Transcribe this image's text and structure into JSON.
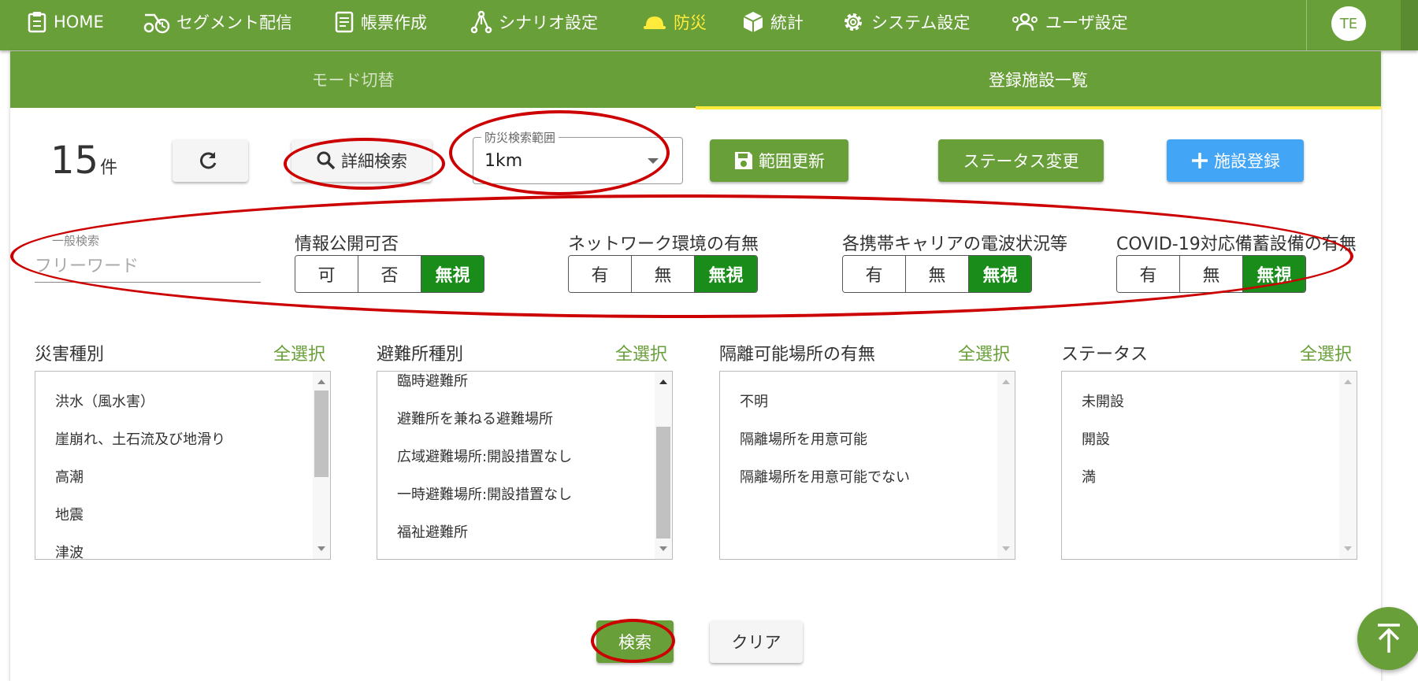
{
  "nav": {
    "items": [
      {
        "label": "HOME",
        "icon": "clipboard-icon"
      },
      {
        "label": "セグメント配信",
        "icon": "scooter-timer-icon"
      },
      {
        "label": "帳票作成",
        "icon": "document-icon"
      },
      {
        "label": "シナリオ設定",
        "icon": "graph-icon"
      },
      {
        "label": "防災",
        "icon": "hardhat-icon",
        "active": true
      },
      {
        "label": "統計",
        "icon": "cube-icon"
      },
      {
        "label": "システム設定",
        "icon": "gear-icon"
      },
      {
        "label": "ユーザ設定",
        "icon": "users-icon"
      }
    ],
    "avatar": "TE"
  },
  "tabs": [
    "モード切替",
    "登録施設一覧"
  ],
  "toolbar": {
    "count": "15",
    "count_unit": "件",
    "detail_search": "詳細検索",
    "range_legend": "防災検索範囲",
    "range_value": "1km",
    "range_update": "範囲更新",
    "status_change": "ステータス変更",
    "add_facility": "施設登録"
  },
  "filters": {
    "free_label": "一般検索",
    "free_placeholder": "フリーワード",
    "groups": [
      {
        "label": "情報公開可否",
        "options": [
          "可",
          "否",
          "無視"
        ],
        "selected": "無視"
      },
      {
        "label": "ネットワーク環境の有無",
        "options": [
          "有",
          "無",
          "無視"
        ],
        "selected": "無視"
      },
      {
        "label": "各携帯キャリアの電波状況等",
        "options": [
          "有",
          "無",
          "無視"
        ],
        "selected": "無視"
      },
      {
        "label": "COVID-19対応備蓄設備の有無",
        "options": [
          "有",
          "無",
          "無視"
        ],
        "selected": "無視"
      }
    ]
  },
  "lists": [
    {
      "title": "災害種別",
      "select_all": "全選択",
      "items": [
        "洪水（風水害）",
        "崖崩れ、土石流及び地滑り",
        "高潮",
        "地震",
        "津波"
      ]
    },
    {
      "title": "避難所種別",
      "select_all": "全選択",
      "items": [
        "臨時避難所",
        "避難所を兼ねる避難場所",
        "広域避難場所:開設措置なし",
        "一時避難場所:開設措置なし",
        "福祉避難所"
      ]
    },
    {
      "title": "隔離可能場所の有無",
      "select_all": "全選択",
      "items": [
        "不明",
        "隔離場所を用意可能",
        "隔離場所を用意可能でない"
      ]
    },
    {
      "title": "ステータス",
      "select_all": "全選択",
      "items": [
        "未開設",
        "開設",
        "満"
      ]
    }
  ],
  "actions": {
    "search": "検索",
    "clear": "クリア"
  },
  "colors": {
    "primary_green": "#689f38",
    "selected_green": "#198c19",
    "blue": "#42a5f5",
    "active_nav": "#ffeb3b",
    "annotation_red": "#cc0000"
  }
}
